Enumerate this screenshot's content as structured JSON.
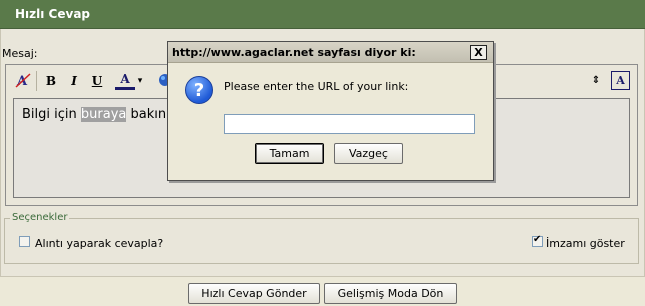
{
  "header": {
    "title": "Hızlı Cevap"
  },
  "editor": {
    "label": "Mesaj:",
    "toolbar": {
      "bold": "B",
      "italic": "I",
      "underline": "U",
      "font_color": "A",
      "dropdown": "▾",
      "resize": "⇕",
      "mode_toggle": "A"
    },
    "text_before": "Bilgi için ",
    "text_selected": "buraya",
    "text_after": " bakın"
  },
  "options": {
    "legend": "Seçenekler",
    "quote_label": "Alıntı yaparak cevapla?",
    "quote_checked": false,
    "signature_label": "İmzamı göster",
    "signature_checked": true
  },
  "buttons": {
    "send": "Hızlı Cevap Gönder",
    "advanced": "Gelişmiş Moda Dön"
  },
  "dialog": {
    "title": "http://www.agaclar.net sayfası diyor ki:",
    "close": "X",
    "icon": "?",
    "message": "Please enter the URL of your link:",
    "input_value": "",
    "ok": "Tamam",
    "cancel": "Vazgeç"
  },
  "colors": {
    "header_bg": "#5a7a4a",
    "legend_text": "#3a6a3a",
    "selection": "#a0a0a0",
    "icon_blue": "#1f5ad6"
  }
}
